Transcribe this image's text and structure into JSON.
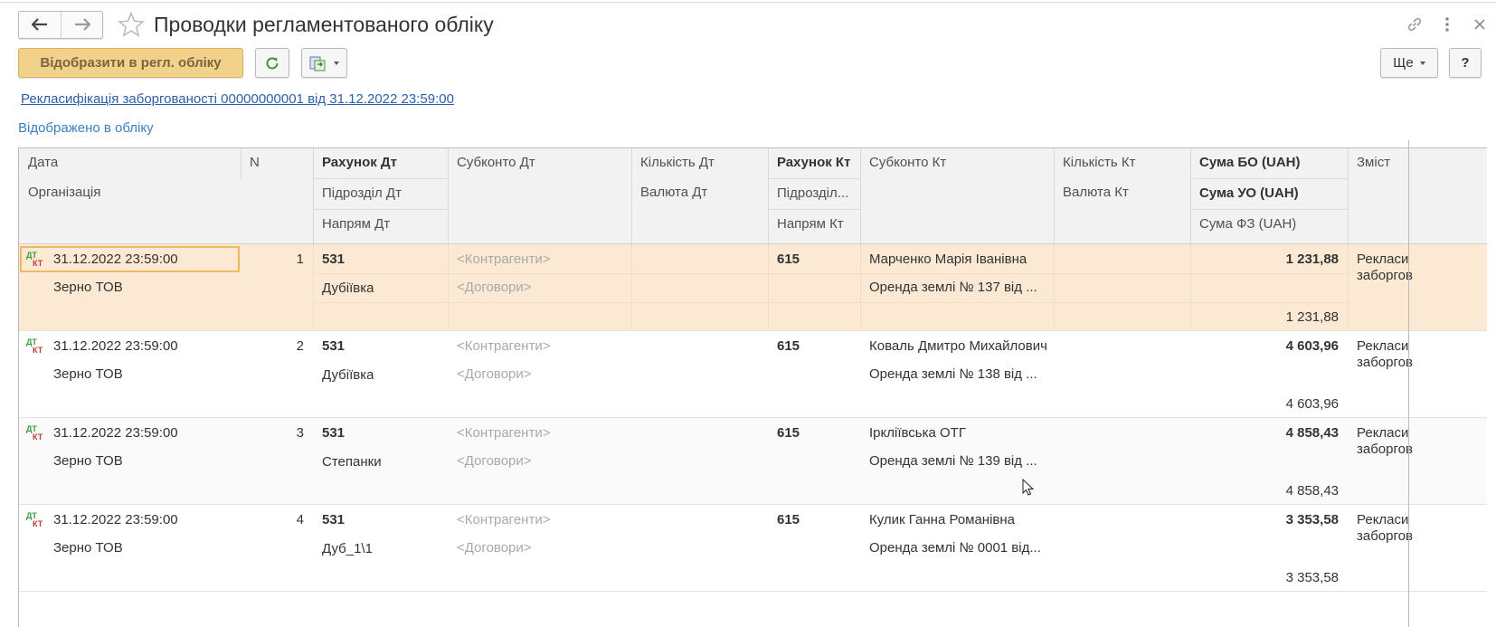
{
  "window": {
    "title": "Проводки регламентованого обліку",
    "back_icon": "arrow-left-icon",
    "forward_icon": "arrow-right-icon",
    "favorite_icon": "star-icon",
    "link_icon": "link-icon",
    "menu_icon": "more-vertical-icon",
    "close_icon": "close-icon"
  },
  "toolbar": {
    "post_label": "Відобразити в регл. обліку",
    "refresh_icon": "refresh-icon",
    "export_icon": "export-icon",
    "more_label": "Ще",
    "help_label": "?"
  },
  "document_link": "Рекласифікація заборгованості 00000000001 від 31.12.2022 23:59:00",
  "status": "Відображено в обліку",
  "columns": {
    "date": "Дата",
    "n": "N",
    "org": "Організація",
    "acc_dt": "Рахунок Дт",
    "dept_dt": "Підрозділ Дт",
    "dir_dt": "Напрям Дт",
    "sub_dt": "Субконто Дт",
    "qty_dt": "Кількість Дт",
    "cur_dt": "Валюта Дт",
    "acc_kt": "Рахунок Кт",
    "dept_kt": "Підрозділ...",
    "dir_kt": "Напрям Кт",
    "sub_kt": "Субконто Кт",
    "qty_kt": "Кількість Кт",
    "cur_kt": "Валюта Кт",
    "sum_bo": "Сума БО (UAH)",
    "sum_uo": "Сума УО (UAH)",
    "sum_fz": "Сума ФЗ (UAH)",
    "content": "Зміст"
  },
  "rows": [
    {
      "date": "31.12.2022 23:59:00",
      "n": "1",
      "org": "Зерно ТОВ",
      "acc_dt": "531",
      "dept_dt": "Дубіївка",
      "sub_dt1": "<Контрагенти>",
      "sub_dt2": "<Договори>",
      "acc_kt": "615",
      "sub_kt1": "Марченко Марія Іванівна",
      "sub_kt2": "Оренда землі № 137 від ...",
      "sum_bo": "1 231,88",
      "sum_fz": "1 231,88",
      "content1": "Рекласи",
      "content2": "заборгов"
    },
    {
      "date": "31.12.2022 23:59:00",
      "n": "2",
      "org": "Зерно ТОВ",
      "acc_dt": "531",
      "dept_dt": "Дубіївка",
      "sub_dt1": "<Контрагенти>",
      "sub_dt2": "<Договори>",
      "acc_kt": "615",
      "sub_kt1": "Коваль Дмитро Михайлович",
      "sub_kt2": "Оренда землі № 138 від ...",
      "sum_bo": "4 603,96",
      "sum_fz": "4 603,96",
      "content1": "Рекласи",
      "content2": "заборгов"
    },
    {
      "date": "31.12.2022 23:59:00",
      "n": "3",
      "org": "Зерно ТОВ",
      "acc_dt": "531",
      "dept_dt": "Степанки",
      "sub_dt1": "<Контрагенти>",
      "sub_dt2": "<Договори>",
      "acc_kt": "615",
      "sub_kt1": "Іркліївська ОТГ",
      "sub_kt2": "Оренда землі № 139 від ...",
      "sum_bo": "4 858,43",
      "sum_fz": "4 858,43",
      "content1": "Рекласи",
      "content2": "заборгов"
    },
    {
      "date": "31.12.2022 23:59:00",
      "n": "4",
      "org": "Зерно ТОВ",
      "acc_dt": "531",
      "dept_dt": "Дуб_1\\1",
      "sub_dt1": "<Контрагенти>",
      "sub_dt2": "<Договори>",
      "acc_kt": "615",
      "sub_kt1": "Кулик Ганна Романівна",
      "sub_kt2": "Оренда землі № 0001 від...",
      "sum_bo": "3 353,58",
      "sum_fz": "3 353,58",
      "content1": "Рекласи",
      "content2": "заборгов"
    }
  ],
  "colors": {
    "primary_button": "#f2d28a",
    "selected_row": "#fbe9d4",
    "link": "#2b5eab",
    "status_text": "#3c7fc0"
  }
}
